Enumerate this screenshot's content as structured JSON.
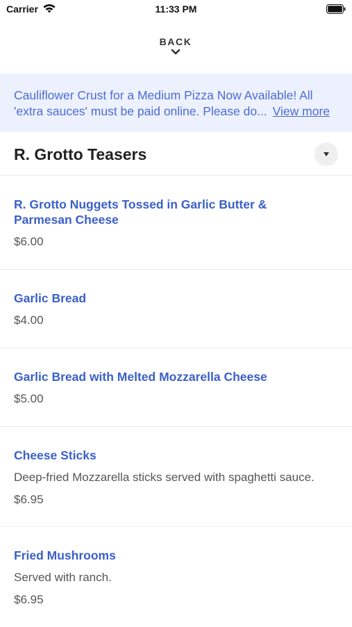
{
  "status_bar": {
    "carrier": "Carrier",
    "time": "11:33 PM"
  },
  "nav": {
    "back_label": "BACK"
  },
  "announcement": {
    "line1": "Cauliflower Crust for a Medium Pizza Now Available! All",
    "line2": "'extra sauces' must be paid online. Please do...",
    "view_more": "View more"
  },
  "section": {
    "title": "R. Grotto Teasers"
  },
  "items": [
    {
      "name_line1": "R. Grotto Nuggets Tossed in Garlic Butter &",
      "name_line2": "Parmesan Cheese",
      "description": "",
      "price": "$6.00"
    },
    {
      "name_line1": "Garlic Bread",
      "name_line2": "",
      "description": "",
      "price": "$4.00"
    },
    {
      "name_line1": "Garlic Bread with Melted Mozzarella Cheese",
      "name_line2": "",
      "description": "",
      "price": "$5.00"
    },
    {
      "name_line1": "Cheese Sticks",
      "name_line2": "",
      "description": "Deep-fried Mozzarella sticks served with spaghetti sauce.",
      "price": "$6.95"
    },
    {
      "name_line1": "Fried Mushrooms",
      "name_line2": "",
      "description": "Served with ranch.",
      "price": "$6.95"
    }
  ],
  "colors": {
    "accent": "#3b5fc9",
    "announcement_bg": "#edf1fd",
    "announcement_text": "#4a6bd6"
  },
  "icons": [
    "wifi-icon",
    "battery-icon",
    "chevron-down-icon",
    "caret-down-icon"
  ]
}
